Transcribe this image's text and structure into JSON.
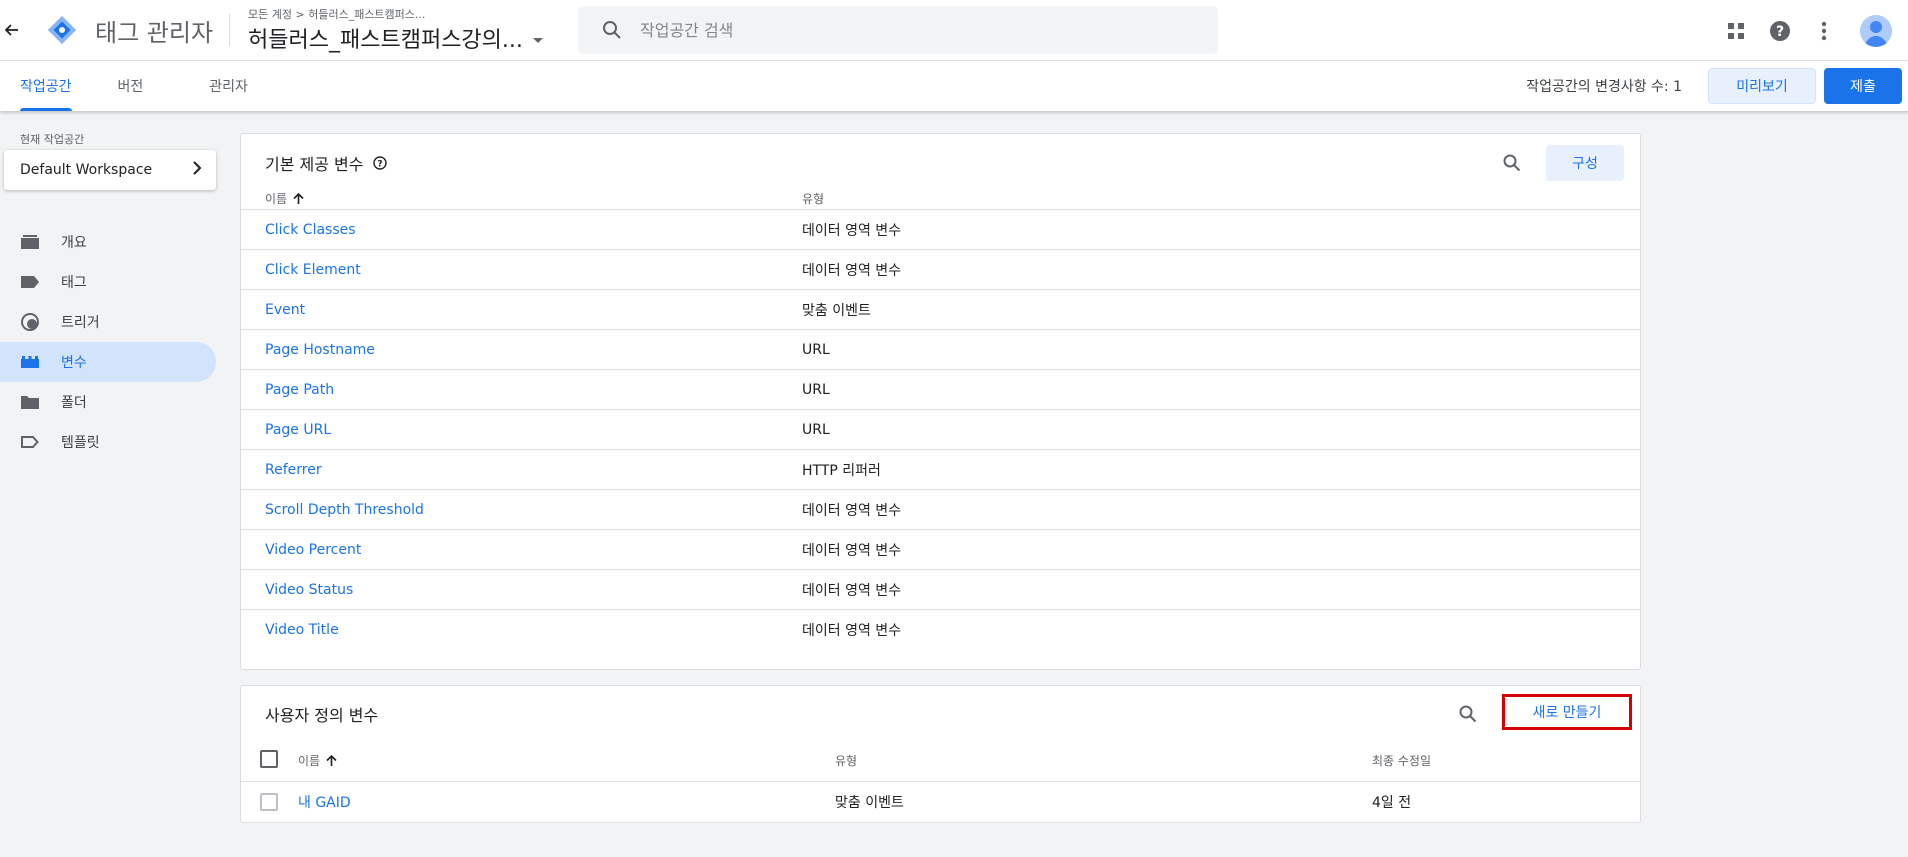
{
  "header": {
    "product_name": "태그 관리자",
    "breadcrumb": "모든 계정 > 허들러스_패스트캠퍼스...",
    "container_name": "허들러스_패스트캠퍼스강의...",
    "search_placeholder": "작업공간 검색",
    "brand_color": "#1a73e8"
  },
  "tabs": [
    {
      "label": "작업공간",
      "active": true
    },
    {
      "label": "버전",
      "active": false
    },
    {
      "label": "관리자",
      "active": false
    }
  ],
  "toolbar": {
    "changes_text": "작업공간의 변경사항 수: 1",
    "preview_label": "미리보기",
    "submit_label": "제출"
  },
  "sidebar": {
    "workspace_label": "현재 작업공간",
    "workspace_name": "Default Workspace",
    "items": [
      {
        "label": "개요",
        "icon": "overview-icon"
      },
      {
        "label": "태그",
        "icon": "tag-icon"
      },
      {
        "label": "트리거",
        "icon": "trigger-icon"
      },
      {
        "label": "변수",
        "icon": "variables-icon",
        "active": true
      },
      {
        "label": "폴더",
        "icon": "folder-icon"
      },
      {
        "label": "템플릿",
        "icon": "template-icon"
      }
    ]
  },
  "builtin": {
    "title": "기본 제공 변수",
    "configure_label": "구성",
    "col_name": "이름",
    "col_type": "유형",
    "rows": [
      {
        "name": "Click Classes",
        "type": "데이터 영역 변수"
      },
      {
        "name": "Click Element",
        "type": "데이터 영역 변수"
      },
      {
        "name": "Event",
        "type": "맞춤 이벤트"
      },
      {
        "name": "Page Hostname",
        "type": "URL"
      },
      {
        "name": "Page Path",
        "type": "URL"
      },
      {
        "name": "Page URL",
        "type": "URL"
      },
      {
        "name": "Referrer",
        "type": "HTTP 리퍼러"
      },
      {
        "name": "Scroll Depth Threshold",
        "type": "데이터 영역 변수"
      },
      {
        "name": "Video Percent",
        "type": "데이터 영역 변수"
      },
      {
        "name": "Video Status",
        "type": "데이터 영역 변수"
      },
      {
        "name": "Video Title",
        "type": "데이터 영역 변수"
      }
    ]
  },
  "custom": {
    "title": "사용자 정의 변수",
    "new_label": "새로 만들기",
    "col_name": "이름",
    "col_type": "유형",
    "col_modified": "최종 수정일",
    "rows": [
      {
        "name": "내 GAID",
        "type": "맞춤 이벤트",
        "modified": "4일 전"
      }
    ]
  }
}
